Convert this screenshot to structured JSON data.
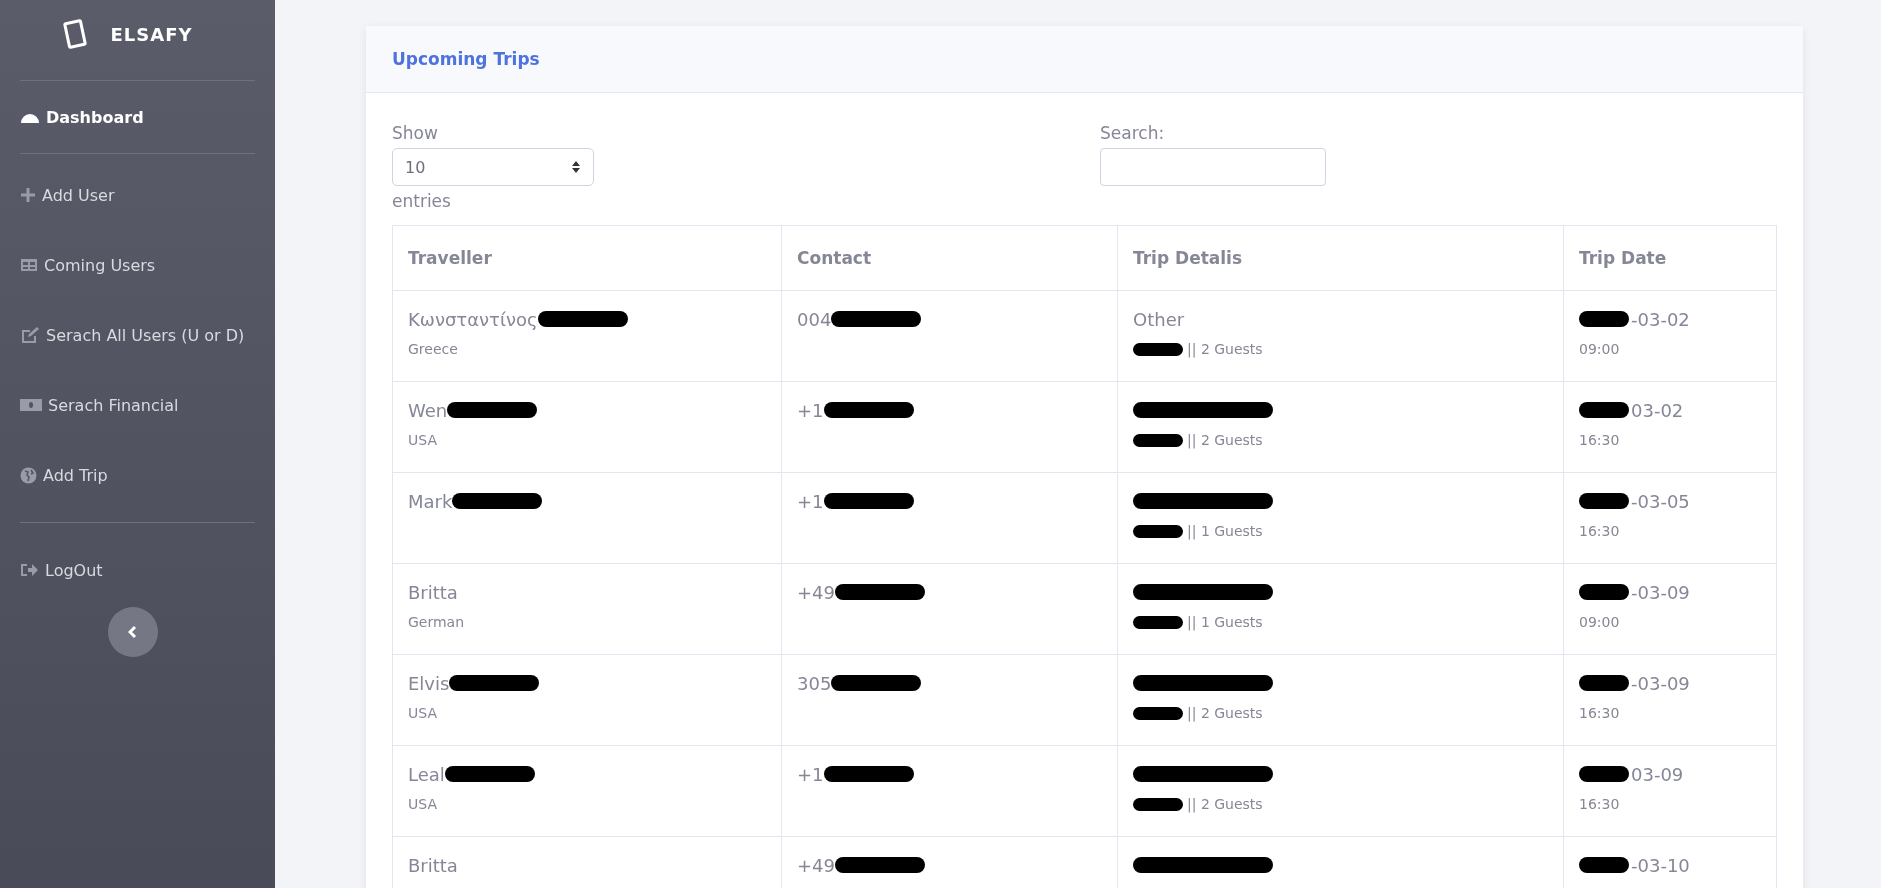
{
  "sidebar": {
    "brand": "ELSAFY",
    "items": [
      {
        "label": "Dashboard",
        "selected": true
      },
      {
        "label": "Add User",
        "selected": false
      },
      {
        "label": "Coming Users",
        "selected": false
      },
      {
        "label": "Serach All Users (U or D)",
        "selected": false
      },
      {
        "label": "Serach Financial",
        "selected": false
      },
      {
        "label": "Add Trip",
        "selected": false
      },
      {
        "label": "LogOut",
        "selected": false
      }
    ]
  },
  "card": {
    "title": "Upcoming Trips",
    "length": {
      "label_before": "Show",
      "value": "10",
      "label_after": "entries"
    },
    "search": {
      "label": "Search:"
    },
    "table": {
      "columns": [
        "Traveller",
        "Contact",
        "Trip Detalis",
        "Trip Date"
      ],
      "rows": [
        {
          "name": {
            "text": "Κωνσταντίνος",
            "mark_before": false,
            "mark_after": true
          },
          "country": "Greece",
          "contact": {
            "text": "004",
            "mark_before": false,
            "mark_after": true
          },
          "trip": {
            "text": "Other",
            "mark_before": false,
            "mark_after": false
          },
          "guests": {
            "text": "|| 2 Guests",
            "mark_before": true,
            "mark_after": false
          },
          "date": {
            "text": "-03-02",
            "mark_before": true,
            "mark_after": false
          },
          "time": "09:00"
        },
        {
          "name": {
            "text": "Wen",
            "mark_before": false,
            "mark_after": true
          },
          "country": "USA",
          "contact": {
            "text": "+1",
            "mark_before": false,
            "mark_after": true
          },
          "trip": {
            "mark_before": true,
            "mark_after": false
          },
          "guests": {
            "text": "|| 2 Guests",
            "mark_before": true,
            "mark_after": false
          },
          "date": {
            "text": "03-02",
            "mark_before": true,
            "mark_after": false
          },
          "time": "16:30"
        },
        {
          "name": {
            "text": "Mark",
            "mark_before": false,
            "mark_after": true
          },
          "contact": {
            "text": "+1",
            "mark_before": false,
            "mark_after": true
          },
          "trip": {
            "mark_before": true,
            "mark_after": false
          },
          "guests": {
            "text": "|| 1 Guests",
            "mark_before": true,
            "mark_after": false
          },
          "date": {
            "text": "-03-05",
            "mark_before": true,
            "mark_after": false
          },
          "time": "16:30"
        },
        {
          "name": {
            "text": "Britta",
            "mark_before": false,
            "mark_after": false
          },
          "country": "German",
          "contact": {
            "text": "+49",
            "mark_before": false,
            "mark_after": true
          },
          "trip": {
            "mark_before": true,
            "mark_after": false
          },
          "guests": {
            "text": "|| 1 Guests",
            "mark_before": true,
            "mark_after": false
          },
          "date": {
            "text": "-03-09",
            "mark_before": true,
            "mark_after": false
          },
          "time": "09:00"
        },
        {
          "name": {
            "text": "Elvis",
            "mark_before": false,
            "mark_after": true
          },
          "country": "USA",
          "contact": {
            "text": "305",
            "mark_before": false,
            "mark_after": true
          },
          "trip": {
            "mark_before": true,
            "mark_after": false
          },
          "guests": {
            "text": "|| 2 Guests",
            "mark_before": true,
            "mark_after": false
          },
          "date": {
            "text": "-03-09",
            "mark_before": true,
            "mark_after": false
          },
          "time": "16:30"
        },
        {
          "name": {
            "text": "Leal",
            "mark_before": false,
            "mark_after": true
          },
          "country": "USA",
          "contact": {
            "text": "+1",
            "mark_before": false,
            "mark_after": true
          },
          "trip": {
            "mark_before": true,
            "mark_after": false
          },
          "guests": {
            "text": "|| 2 Guests",
            "mark_before": true,
            "mark_after": false
          },
          "date": {
            "text": "03-09",
            "mark_before": true,
            "mark_after": false
          },
          "time": "16:30"
        },
        {
          "name": {
            "text": "Britta",
            "mark_before": false,
            "mark_after": false
          },
          "contact": {
            "text": "+49",
            "mark_before": false,
            "mark_after": true
          },
          "trip": {
            "mark_before": true,
            "mark_after": false
          },
          "date": {
            "text": "-03-10",
            "mark_before": true,
            "mark_after": false
          }
        }
      ]
    }
  }
}
